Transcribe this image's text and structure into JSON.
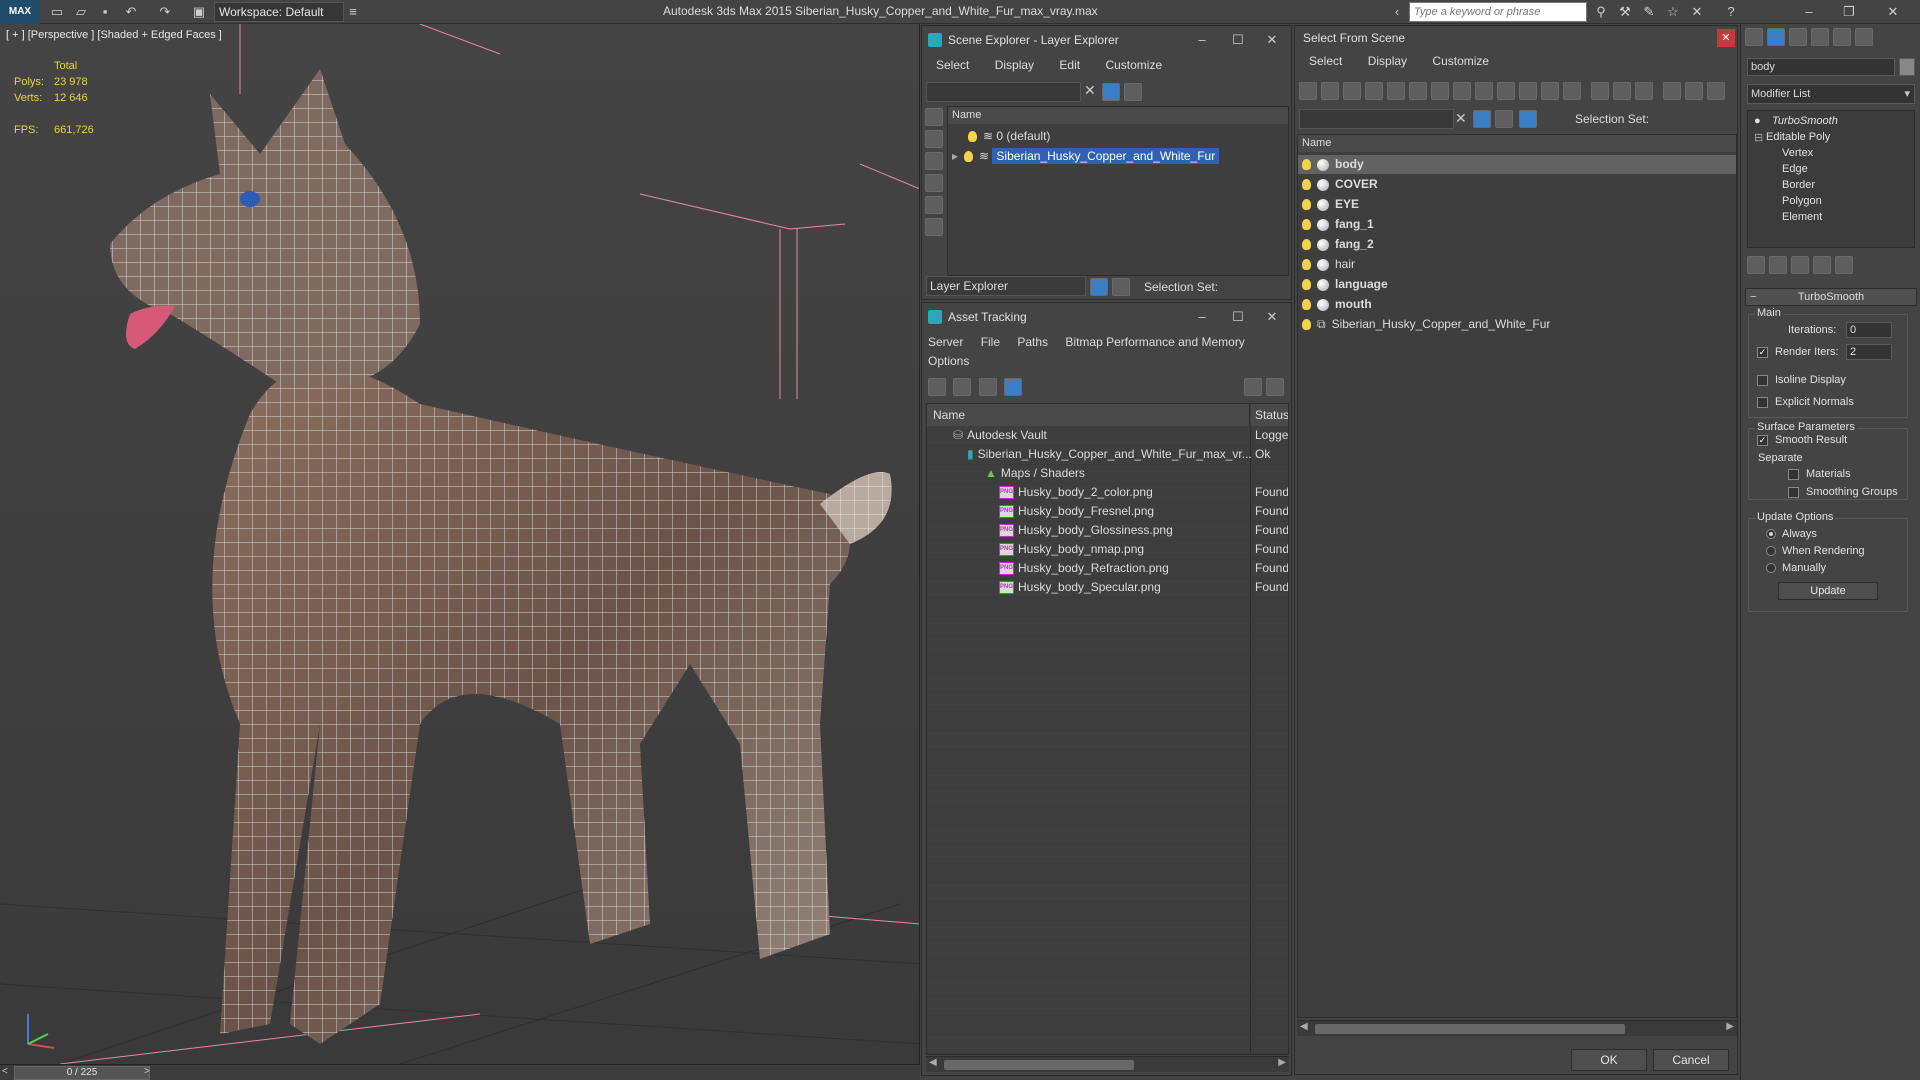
{
  "titlebar": {
    "app_title": "Autodesk 3ds Max  2015    Siberian_Husky_Copper_and_White_Fur_max_vray.max",
    "workspace": "Workspace: Default",
    "search_placeholder": "Type a keyword or phrase",
    "logo": "MAX"
  },
  "viewport": {
    "label": "[ + ] [Perspective ] [Shaded + Edged Faces ]",
    "stats": {
      "total_label": "Total",
      "polys_label": "Polys:",
      "polys_value": "23 978",
      "verts_label": "Verts:",
      "verts_value": "12 646",
      "fps_label": "FPS:",
      "fps_value": "661,726"
    }
  },
  "timeline": {
    "frame": "0 / 225",
    "prev": "<",
    "next": ">"
  },
  "scene_explorer": {
    "title": "Scene Explorer - Layer Explorer",
    "menu": [
      "Select",
      "Display",
      "Edit",
      "Customize"
    ],
    "column_name": "Name",
    "rows": [
      "0 (default)",
      "Siberian_Husky_Copper_and_White_Fur"
    ],
    "footer_dropdown": "Layer Explorer",
    "selection_set_label": "Selection Set:"
  },
  "asset_tracking": {
    "title": "Asset Tracking",
    "menu": [
      "Server",
      "File",
      "Paths",
      "Bitmap Performance and Memory"
    ],
    "menu2": "Options",
    "col_name": "Name",
    "col_status": "Status",
    "rows": [
      {
        "name": "Autodesk Vault",
        "status": "Logged"
      },
      {
        "name": "Siberian_Husky_Copper_and_White_Fur_max_vr...",
        "status": "Ok"
      },
      {
        "name": "Maps / Shaders",
        "status": ""
      },
      {
        "name": "Husky_body_2_color.png",
        "status": "Found"
      },
      {
        "name": "Husky_body_Fresnel.png",
        "status": "Found"
      },
      {
        "name": "Husky_body_Glossiness.png",
        "status": "Found"
      },
      {
        "name": "Husky_body_nmap.png",
        "status": "Found"
      },
      {
        "name": "Husky_body_Refraction.png",
        "status": "Found"
      },
      {
        "name": "Husky_body_Specular.png",
        "status": "Found"
      }
    ]
  },
  "select_from_scene": {
    "title": "Select From Scene",
    "menu": [
      "Select",
      "Display",
      "Customize"
    ],
    "selection_set_label": "Selection Set:",
    "column_name": "Name",
    "objects": [
      "body",
      "COVER",
      "EYE",
      "fang_1",
      "fang_2",
      "hair",
      "language",
      "mouth",
      "Siberian_Husky_Copper_and_White_Fur"
    ],
    "ok": "OK",
    "cancel": "Cancel"
  },
  "modifier_panel": {
    "object_name": "body",
    "modifier_list": "Modifier List",
    "stack": [
      "TurboSmooth",
      "Editable Poly",
      "Vertex",
      "Edge",
      "Border",
      "Polygon",
      "Element"
    ],
    "rollout_title": "TurboSmooth",
    "main": "Main",
    "iterations_label": "Iterations:",
    "iterations_value": "0",
    "render_iters_label": "Render Iters:",
    "render_iters_value": "2",
    "isoline": "Isoline Display",
    "explicit_normals": "Explicit Normals",
    "surface_params": "Surface Parameters",
    "smooth_result": "Smooth Result",
    "separate": "Separate",
    "materials": "Materials",
    "smoothing_groups": "Smoothing Groups",
    "update_options": "Update Options",
    "always": "Always",
    "when_rendering": "When Rendering",
    "manually": "Manually",
    "update_btn": "Update"
  },
  "icons": [
    "undo-icon",
    "redo-icon",
    "open-icon",
    "save-icon",
    "help-icon",
    "close-icon",
    "minimize-icon",
    "maximize-icon"
  ]
}
